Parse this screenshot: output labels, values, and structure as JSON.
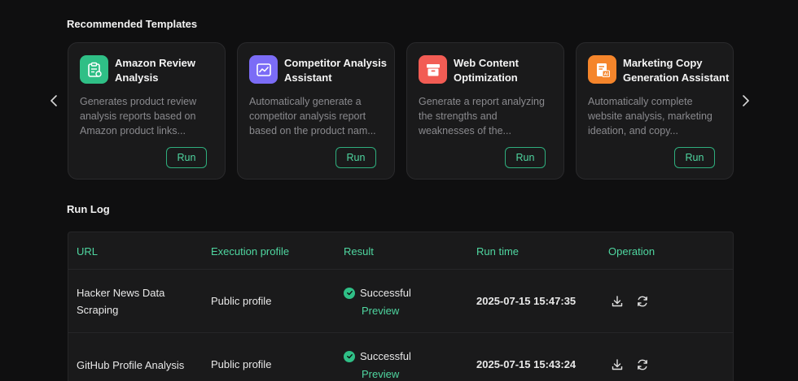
{
  "recommended": {
    "title": "Recommended Templates",
    "cards": [
      {
        "title": "Amazon Review Analysis",
        "description": "Generates product review analysis reports based on Amazon product links...",
        "run_label": "Run",
        "icon": "clipboard-icon",
        "icon_color": "#2fbf86"
      },
      {
        "title": "Competitor Analysis Assistant",
        "description": "Automatically generate a competitor analysis report based on the product nam...",
        "run_label": "Run",
        "icon": "chart-line-icon",
        "icon_color": "#7b6cf6"
      },
      {
        "title": "Web Content Optimization",
        "description": "Generate a report analyzing the strengths and weaknesses of the...",
        "run_label": "Run",
        "icon": "archive-box-icon",
        "icon_color": "#f25c54"
      },
      {
        "title": "Marketing Copy Generation Assistant",
        "description": "Automatically complete website analysis, marketing ideation, and copy...",
        "run_label": "Run",
        "icon": "ai-document-icon",
        "icon_color": "#f5852b"
      }
    ]
  },
  "run_log": {
    "title": "Run Log",
    "columns": [
      "URL",
      "Execution profile",
      "Result",
      "Run time",
      "Operation"
    ],
    "rows": [
      {
        "url": "Hacker News Data Scraping",
        "profile": "Public profile",
        "status": "Successful",
        "preview_label": "Preview",
        "run_time": "2025-07-15 15:47:35"
      },
      {
        "url": "GitHub Profile Analysis",
        "profile": "Public profile",
        "status": "Successful",
        "preview_label": "Preview",
        "run_time": "2025-07-15 15:43:24"
      }
    ]
  },
  "colors": {
    "accent": "#4fd6a0",
    "background": "#0f0f10",
    "card": "#1a1a1b"
  }
}
